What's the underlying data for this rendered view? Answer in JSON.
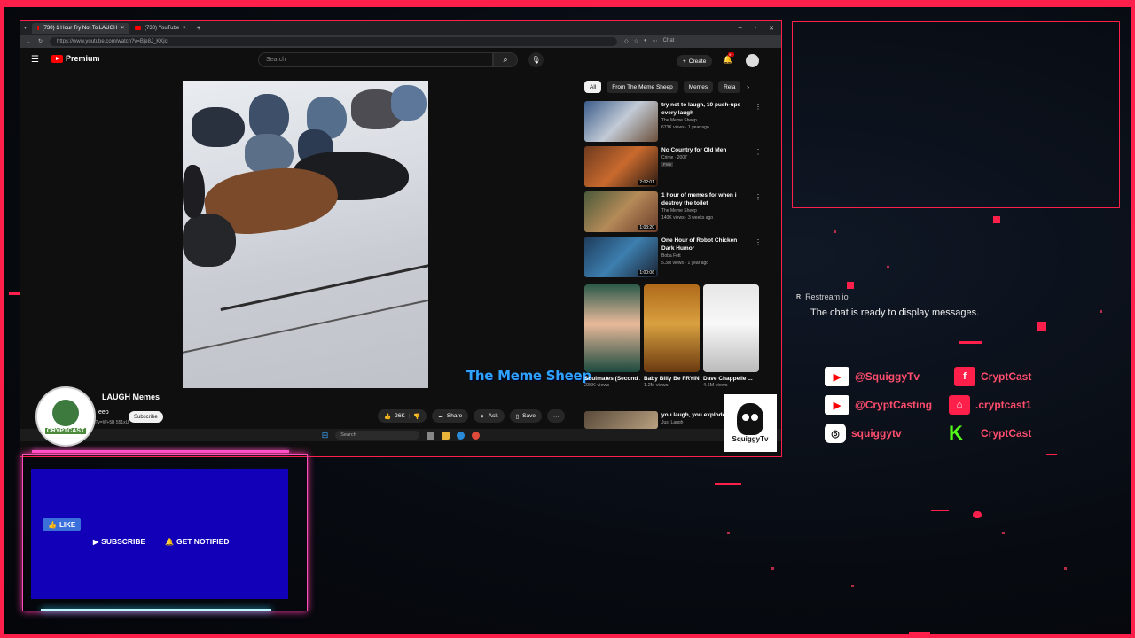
{
  "browser": {
    "tabs": [
      {
        "label": "(730) 1 Hour Try Not To LAUGH"
      },
      {
        "label": "(730) YouTube"
      }
    ],
    "url": "https://www.youtube.com/watch?v=Bje8J_KKjc",
    "chat_button": "Chat"
  },
  "youtube": {
    "brand": "Premium",
    "search_placeholder": "Search",
    "create_label": "Create",
    "notif_count": "9+",
    "video_title": "LAUGH Memes",
    "channel": "eep",
    "subs_text": "v?v=W+5B 551xU",
    "subscribe_label": "Subscribe",
    "likes": "26K",
    "actions": [
      "Share",
      "Ask",
      "Save"
    ],
    "watermark": "The Meme Sheep",
    "chips": [
      "All",
      "From The Meme Sheep",
      "Memes",
      "Rela"
    ],
    "recs": [
      {
        "title": "try not to laugh, 10 push-ups every laugh",
        "channel": "The Meme Sheep",
        "meta": "673K views · 1 year ago",
        "duration": ""
      },
      {
        "title": "No Country for Old Men",
        "channel": "Crime · 2007",
        "meta": "Free",
        "duration": "2:02:01"
      },
      {
        "title": "1 hour of memes for when i destroy the toilet",
        "channel": "The Meme Sheep",
        "meta": "140K views · 3 weeks ago",
        "duration": "1:03:20"
      },
      {
        "title": "One Hour of Robot Chicken Dark Humor",
        "channel": "Boba Fett",
        "meta": "5.3M views · 1 year ago",
        "duration": "1:00:06"
      }
    ],
    "shorts": [
      {
        "title": "Soulmates (Second ...",
        "views": "236K views"
      },
      {
        "title": "Baby Billy Be FRYIN' ME...",
        "views": "1.2M views"
      },
      {
        "title": "Dave Chappelle ...",
        "views": "4.6M views"
      }
    ],
    "last_rec_title": "you laugh, you explode",
    "last_rec_channel": "Just Laugh",
    "taskbar_search": "Search"
  },
  "overlay": {
    "left_logo": "CRYPTCAST",
    "right_logo": "SquiggyTv",
    "chat_source": "Restream.io",
    "chat_message": "The chat is ready to display messages.",
    "socials": [
      {
        "icon": "youtube-icon",
        "handle": "@SquiggyTv"
      },
      {
        "icon": "facebook-icon",
        "handle": "CryptCast"
      },
      {
        "icon": "youtube-icon",
        "handle": "@CryptCasting"
      },
      {
        "icon": "twitch-icon",
        "handle": ".cryptcast1"
      },
      {
        "icon": "instagram-icon",
        "handle": "squiggytv"
      },
      {
        "icon": "kick-icon",
        "handle": "CryptCast"
      }
    ],
    "like_label": "LIKE",
    "subscribe_label": "SUBSCRIBE",
    "notify_label": "GET NOTIFIED"
  },
  "colors": {
    "accent": "#ff1f4b",
    "youtube_red": "#ff0000",
    "panel_blue": "#1200b8",
    "watermark_blue": "#2fa4ff"
  }
}
